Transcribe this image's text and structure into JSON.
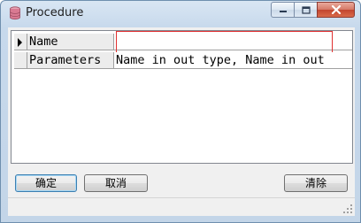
{
  "window": {
    "title": "Procedure",
    "icon": "database-icon"
  },
  "caption_buttons": [
    "minimize-icon",
    "maximize-icon",
    "close-icon"
  ],
  "grid": {
    "rows": [
      {
        "name": "Name",
        "value": "",
        "current": true
      },
      {
        "name": "Parameters",
        "value": "Name in out type, Name in out"
      }
    ]
  },
  "buttons": {
    "ok_label": "确定",
    "cancel_label": "取消",
    "clear_label": "清除"
  },
  "colors": {
    "highlight_box": "#e03030",
    "close_button": "#c2452f",
    "default_button_border": "#3c7fb1"
  }
}
